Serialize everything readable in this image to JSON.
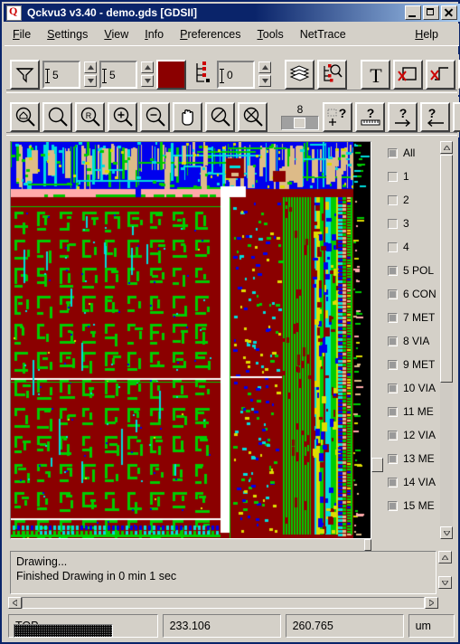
{
  "window": {
    "title": "Qckvu3 v3.40 - demo.gds [GDSII]",
    "icon": "app-icon",
    "minimize_label": "Minimize",
    "maximize_label": "Maximize",
    "close_label": "Close"
  },
  "menu": {
    "items": [
      {
        "label": "File",
        "mnemonic": "F"
      },
      {
        "label": "Settings",
        "mnemonic": "S"
      },
      {
        "label": "View",
        "mnemonic": "V"
      },
      {
        "label": "Info",
        "mnemonic": "I"
      },
      {
        "label": "Preferences",
        "mnemonic": "P"
      },
      {
        "label": "Tools",
        "mnemonic": "T"
      },
      {
        "label": "NetTrace",
        "mnemonic": ""
      }
    ],
    "help": {
      "label": "Help",
      "mnemonic": "H"
    }
  },
  "toolbar_top": {
    "filter_button": "filter",
    "level_spin": {
      "value": "5",
      "name": "dotted-level-spin"
    },
    "depth_spin": {
      "value": "5",
      "name": "text-level-spin"
    },
    "color_swatch": {
      "color": "#8b0000",
      "name": "layer-color-swatch"
    },
    "hier_spin": {
      "value": "0",
      "name": "hierarchy-depth-spin"
    },
    "layers_button": "layers",
    "layer_search_button": "hierarchy-search",
    "text_button": "T",
    "hide_box_button": "hide-boxes",
    "hide_path_button": "hide-paths",
    "hide_fill_button": "hide-fill"
  },
  "toolbar_zoom": {
    "buttons": [
      "zoom-home",
      "zoom-window",
      "zoom-previous",
      "zoom-in",
      "zoom-out",
      "pan-hand",
      "zoom-fit-x",
      "zoom-fit-y"
    ],
    "depth_widget": {
      "value": "8",
      "name": "display-depth"
    },
    "query_buttons": [
      "query-area",
      "measure-distance",
      "query-next",
      "query-previous",
      "query-loop"
    ]
  },
  "layers": {
    "scroll_up": "scroll-up",
    "scroll_down": "scroll-down",
    "rows": [
      {
        "label": "All",
        "checked": true
      },
      {
        "label": "1",
        "checked": false
      },
      {
        "label": "2",
        "checked": false
      },
      {
        "label": "3",
        "checked": false
      },
      {
        "label": "4",
        "checked": false
      },
      {
        "label": "5 POL",
        "checked": true
      },
      {
        "label": "6 CON",
        "checked": true
      },
      {
        "label": "7 MET",
        "checked": true
      },
      {
        "label": "8 VIA",
        "checked": true
      },
      {
        "label": "9 MET",
        "checked": true
      },
      {
        "label": "10 VIA",
        "checked": true
      },
      {
        "label": "11 ME",
        "checked": true
      },
      {
        "label": "12 VIA",
        "checked": true
      },
      {
        "label": "13 ME",
        "checked": true
      },
      {
        "label": "14 VIA",
        "checked": true
      },
      {
        "label": "15 ME",
        "checked": true
      }
    ]
  },
  "status": {
    "message_line1": "Drawing...",
    "message_line2": "Finished Drawing in 0 min 1 sec",
    "cell": "TOP",
    "x": "233.106",
    "y": "260.765",
    "units": "um"
  },
  "canvas": {
    "name": "gds-layout-canvas",
    "background": "#000000",
    "palette": {
      "substrate": "#8b0000",
      "poly": "#00cc00",
      "metal1": "#0000ee",
      "metal2": "#00dddd",
      "metal3": "#ddbb88",
      "pink": "#ffaaaa",
      "yellow": "#dddd00",
      "white": "#ffffff"
    }
  }
}
